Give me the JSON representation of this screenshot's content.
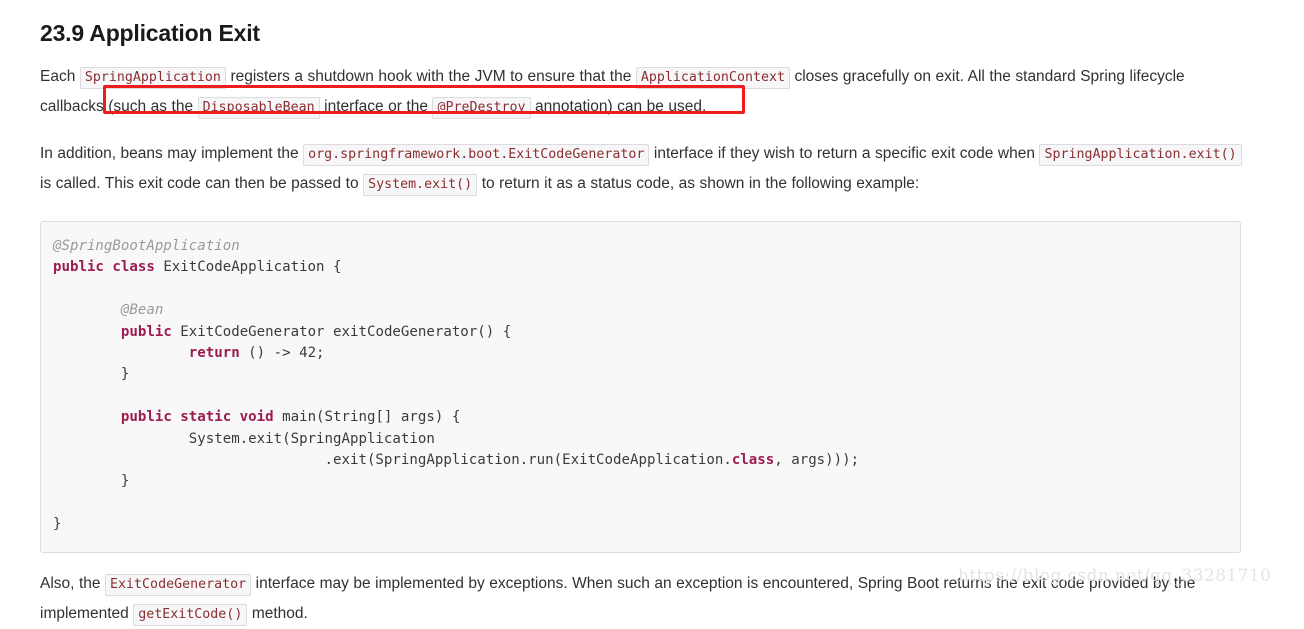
{
  "heading": "23.9 Application Exit",
  "paragraph1": {
    "t1": "Each ",
    "c1": "SpringApplication",
    "t2": " registers a shutdown hook with the JVM to ensure that the ",
    "c2": "ApplicationContext",
    "t3": " closes gracefully on exit. All the standard Spring lifecycle callbacks (such as the ",
    "c3": "DisposableBean",
    "t4": " interface or the ",
    "c4": "@PreDestroy",
    "t5": " annotation) can be used."
  },
  "paragraph2": {
    "t1": "In addition, beans may implement the ",
    "c1": "org.springframework.boot.ExitCodeGenerator",
    "t2": " interface if they wish to return a specific exit code when ",
    "c2": "SpringApplication.exit()",
    "t3": " is called. This exit code can then be passed to ",
    "c3": "System.exit()",
    "t4": " to return it as a status code, as shown in the following example:"
  },
  "paragraph3": {
    "t1": "Also, the ",
    "c1": "ExitCodeGenerator",
    "t2": " interface may be implemented by exceptions. When such an exception is encountered, Spring Boot returns the exit code provided by the implemented ",
    "c2": "getExitCode()",
    "t3": " method."
  },
  "code": {
    "language": "java",
    "lines": [
      {
        "tokens": [
          {
            "t": "@SpringBootApplication",
            "c": "ann"
          }
        ]
      },
      {
        "tokens": [
          {
            "t": "public class",
            "c": "k"
          },
          {
            "t": " ExitCodeApplication {",
            "c": "pl"
          }
        ]
      },
      {
        "tokens": [
          {
            "t": "",
            "c": "pl"
          }
        ]
      },
      {
        "tokens": [
          {
            "t": "        ",
            "c": "pl"
          },
          {
            "t": "@Bean",
            "c": "ann"
          }
        ]
      },
      {
        "tokens": [
          {
            "t": "        ",
            "c": "pl"
          },
          {
            "t": "public",
            "c": "k"
          },
          {
            "t": " ExitCodeGenerator exitCodeGenerator() {",
            "c": "pl"
          }
        ]
      },
      {
        "tokens": [
          {
            "t": "                ",
            "c": "pl"
          },
          {
            "t": "return",
            "c": "k"
          },
          {
            "t": " () -> 42;",
            "c": "pl"
          }
        ]
      },
      {
        "tokens": [
          {
            "t": "        }",
            "c": "pl"
          }
        ]
      },
      {
        "tokens": [
          {
            "t": "",
            "c": "pl"
          }
        ]
      },
      {
        "tokens": [
          {
            "t": "        ",
            "c": "pl"
          },
          {
            "t": "public static void",
            "c": "k"
          },
          {
            "t": " main(String[] args) {",
            "c": "pl"
          }
        ]
      },
      {
        "tokens": [
          {
            "t": "                System.exit(SpringApplication",
            "c": "pl"
          }
        ]
      },
      {
        "tokens": [
          {
            "t": "                                .exit(SpringApplication.run(ExitCodeApplication.",
            "c": "pl"
          },
          {
            "t": "class",
            "c": "k"
          },
          {
            "t": ", args)));",
            "c": "pl"
          }
        ]
      },
      {
        "tokens": [
          {
            "t": "        }",
            "c": "pl"
          }
        ]
      },
      {
        "tokens": [
          {
            "t": "",
            "c": "pl"
          }
        ]
      },
      {
        "tokens": [
          {
            "t": "}",
            "c": "pl"
          }
        ]
      }
    ]
  },
  "annotation": {
    "shape": "rectangle",
    "color": "#ee1c1c"
  },
  "watermark": "https://blog.csdn.net/qq_33281710"
}
